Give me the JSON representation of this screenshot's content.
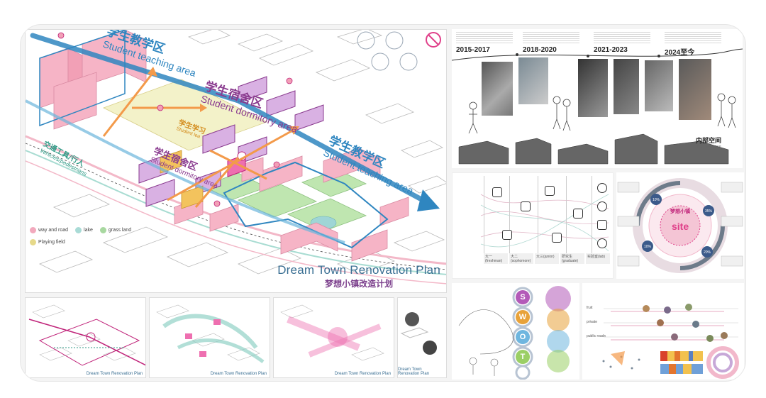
{
  "main_map": {
    "zones": {
      "teaching_top": {
        "cn": "学生教学区",
        "en": "Student teaching area"
      },
      "dormitory_top": {
        "cn": "学生宿舍区",
        "en": "Student dormitory area"
      },
      "teaching_right": {
        "cn": "学生教学区",
        "en": "Student teaching area"
      },
      "dormitory_left": {
        "cn": "学生宿舍区",
        "en": "Student dormitory area"
      },
      "vehicles": {
        "cn": "交通工具/行人",
        "en": "Vehicles/pedestrians"
      },
      "learning_center": {
        "cn": "学生学习",
        "en": "Student lea"
      }
    },
    "legend": [
      {
        "label": "way and road",
        "color": "#f2a9bd"
      },
      {
        "label": "lake",
        "color": "#a9dbd6"
      },
      {
        "label": "grass land",
        "color": "#a8d8a0"
      },
      {
        "label": "Playing field",
        "color": "#e6d98a"
      }
    ],
    "title_en": "Dream Town Renovation Plan",
    "title_cn": "梦想小镇改造计划",
    "colors": {
      "pink": "#f5a8bd",
      "blue": "#2f86c0",
      "purple": "#8a3b8f",
      "orange": "#f39a4a",
      "green": "#b9e3a8",
      "yellow": "#f1c15a"
    }
  },
  "small_maps": [
    {
      "caption": "Dream Town Renovation Plan"
    },
    {
      "caption": "Dream Town Renovation Plan"
    },
    {
      "caption": "Dream Town Renovation Plan"
    },
    {
      "caption": "Dream Town Renovation Plan"
    }
  ],
  "timeline": {
    "years": [
      "2015-2017",
      "2018-2020",
      "2021-2023",
      "2024至今"
    ],
    "interior": {
      "cn": "内部空间",
      "en": "Internal space"
    }
  },
  "analysis": {
    "footer": [
      "大一(freshman)",
      "大二(sophomore)",
      "大三(junior)",
      "研究生(graduate)",
      "实验室(lab)"
    ]
  },
  "site": {
    "cn": "梦想小镇",
    "big": "site",
    "percents": [
      "10%",
      "35%",
      "10%",
      "20%"
    ]
  },
  "swot": {
    "letters": [
      "S",
      "W",
      "O",
      "T"
    ],
    "colors": [
      "#b35ab8",
      "#e8a23a",
      "#6fb6df",
      "#9bcf66"
    ]
  },
  "datapanel": {
    "rows": [
      "fruit",
      "private",
      "public roads"
    ]
  }
}
